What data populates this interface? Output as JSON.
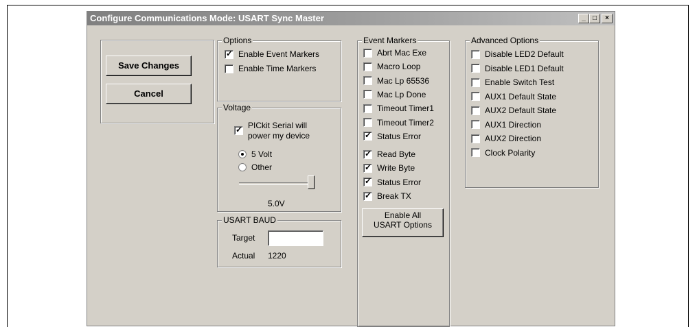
{
  "window": {
    "title": "Configure Communications Mode: USART Sync Master",
    "minimize_glyph": "_",
    "maximize_glyph": "□",
    "close_glyph": "×"
  },
  "actions": {
    "save_label": "Save Changes",
    "cancel_label": "Cancel"
  },
  "options": {
    "title": "Options",
    "items": [
      {
        "label": "Enable Event Markers",
        "checked": true
      },
      {
        "label": "Enable Time Markers",
        "checked": false
      }
    ]
  },
  "voltage": {
    "title": "Voltage",
    "power_label_line1": "PICkit Serial will",
    "power_label_line2": "power my device",
    "power_checked": true,
    "radio_5v": "5 Volt",
    "radio_other": "Other",
    "selected": "5 Volt",
    "slider_fraction": 1.0,
    "value_text": "5.0V"
  },
  "baud": {
    "title": "USART  BAUD",
    "target_label": "Target",
    "target_value": "",
    "actual_label": "Actual",
    "actual_value": "1220"
  },
  "event_markers": {
    "title": "Event Markers",
    "items": [
      {
        "label": "Abrt Mac Exe",
        "checked": false
      },
      {
        "label": "Macro Loop",
        "checked": false
      },
      {
        "label": "Mac Lp 65536",
        "checked": false
      },
      {
        "label": "Mac Lp Done",
        "checked": false
      },
      {
        "label": "Timeout Timer1",
        "checked": false
      },
      {
        "label": "Timeout Timer2",
        "checked": false
      },
      {
        "label": "Status Error",
        "checked": true
      },
      {
        "label": "Read Byte",
        "checked": true
      },
      {
        "label": "Write Byte",
        "checked": true
      },
      {
        "label": "Status Error",
        "checked": true
      },
      {
        "label": "Break TX",
        "checked": true
      }
    ],
    "enable_all_line1": "Enable All",
    "enable_all_line2": "USART Options"
  },
  "advanced": {
    "title": "Advanced Options",
    "items": [
      {
        "label": "Disable LED2 Default",
        "checked": false
      },
      {
        "label": "Disable LED1 Default",
        "checked": false
      },
      {
        "label": "Enable Switch Test",
        "checked": false
      },
      {
        "label": "AUX1 Default State",
        "checked": false
      },
      {
        "label": "AUX2 Default State",
        "checked": false
      },
      {
        "label": "AUX1 Direction",
        "checked": false
      },
      {
        "label": "AUX2 Direction",
        "checked": false
      },
      {
        "label": "Clock Polarity",
        "checked": false
      }
    ]
  },
  "checkmark_glyph": "✓"
}
